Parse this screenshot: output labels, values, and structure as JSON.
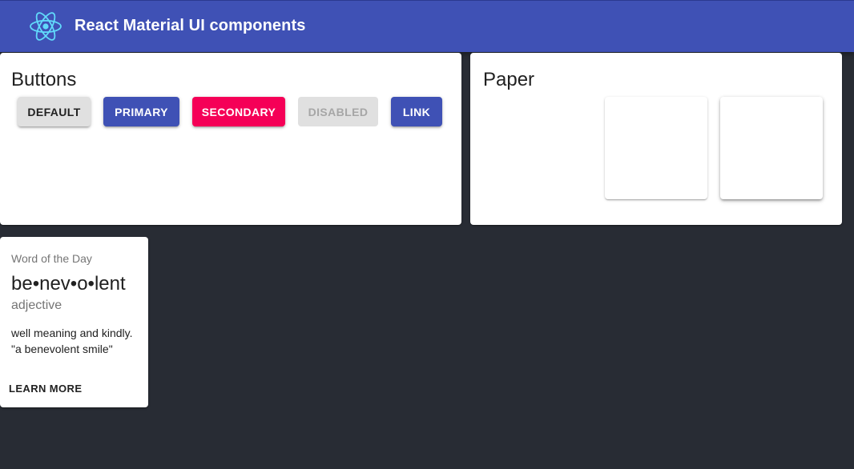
{
  "appbar": {
    "title": "React Material UI components",
    "logo_icon": "react-atom-icon",
    "background": "#3f51b5"
  },
  "buttons_card": {
    "heading": "Buttons",
    "buttons": [
      {
        "label": "Default",
        "variant": "default",
        "color": "#e0e0e0"
      },
      {
        "label": "Primary",
        "variant": "primary",
        "color": "#3f51b5"
      },
      {
        "label": "Secondary",
        "variant": "secondary",
        "color": "#f50057"
      },
      {
        "label": "Disabled",
        "variant": "disabled",
        "color": "#e0e0e0",
        "disabled": true
      },
      {
        "label": "Link",
        "variant": "link",
        "color": "#3f51b5"
      }
    ]
  },
  "paper_card": {
    "heading": "Paper"
  },
  "word_card": {
    "caption": "Word of the Day",
    "word": "be•nev•o•lent",
    "part_of_speech": "adjective",
    "definition": "well meaning and kindly.",
    "example": "\"a benevolent smile\"",
    "action_label": "Learn More"
  },
  "colors": {
    "page_background": "#282c34",
    "primary": "#3f51b5",
    "secondary": "#f50057",
    "logo": "#61dafb"
  }
}
